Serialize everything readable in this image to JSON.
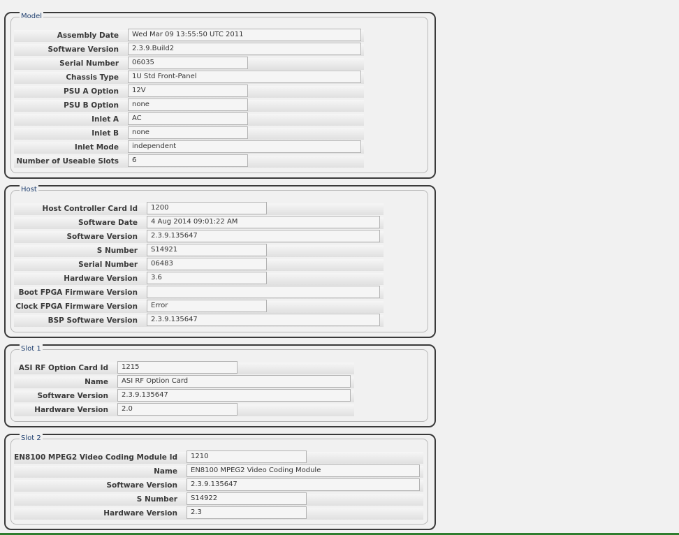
{
  "panels": {
    "model": {
      "legend": "Model",
      "rows": [
        {
          "label": "Assembly Date",
          "value": "Wed Mar 09 13:55:50 UTC 2011"
        },
        {
          "label": "Software Version",
          "value": "2.3.9.Build2"
        },
        {
          "label": "Serial Number",
          "value": "06035"
        },
        {
          "label": "Chassis Type",
          "value": "1U Std Front-Panel"
        },
        {
          "label": "PSU A Option",
          "value": "12V"
        },
        {
          "label": "PSU B Option",
          "value": "none"
        },
        {
          "label": "Inlet A",
          "value": "AC"
        },
        {
          "label": "Inlet B",
          "value": "none"
        },
        {
          "label": "Inlet Mode",
          "value": "independent"
        },
        {
          "label": "Number of Useable Slots",
          "value": "6"
        }
      ]
    },
    "host": {
      "legend": "Host",
      "rows": [
        {
          "label": "Host Controller Card Id",
          "value": "1200"
        },
        {
          "label": "Software Date",
          "value": " 4 Aug 2014 09:01:22 AM"
        },
        {
          "label": "Software Version",
          "value": "2.3.9.135647"
        },
        {
          "label": "S Number",
          "value": "S14921"
        },
        {
          "label": "Serial Number",
          "value": "06483"
        },
        {
          "label": "Hardware Version",
          "value": "3.6"
        },
        {
          "label": "Boot FPGA Firmware Version",
          "value": ""
        },
        {
          "label": "Clock FPGA Firmware Version",
          "value": "Error"
        },
        {
          "label": "BSP Software Version",
          "value": "2.3.9.135647"
        }
      ]
    },
    "slot1": {
      "legend": "Slot 1",
      "rows": [
        {
          "label": "ASI RF Option Card Id",
          "value": "1215"
        },
        {
          "label": "Name",
          "value": "ASI RF Option Card"
        },
        {
          "label": "Software Version",
          "value": "2.3.9.135647"
        },
        {
          "label": "Hardware Version",
          "value": "2.0"
        }
      ]
    },
    "slot2": {
      "legend": "Slot 2",
      "rows": [
        {
          "label": "EN8100 MPEG2 Video Coding Module Id",
          "value": "1210"
        },
        {
          "label": "Name",
          "value": "EN8100 MPEG2 Video Coding Module"
        },
        {
          "label": "Software Version",
          "value": "2.3.9.135647"
        },
        {
          "label": "S Number",
          "value": "S14922"
        },
        {
          "label": "Hardware Version",
          "value": "2.3"
        }
      ]
    }
  }
}
